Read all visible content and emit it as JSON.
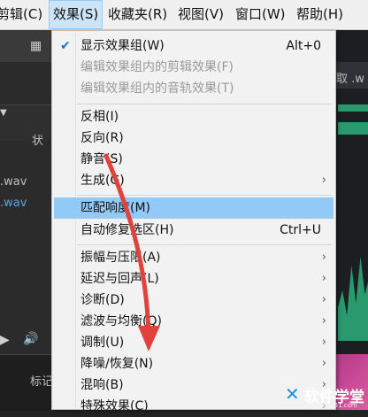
{
  "menubar": {
    "items": [
      {
        "label": "剪辑(C)"
      },
      {
        "label": "效果(S)"
      },
      {
        "label": "收藏夹(R)"
      },
      {
        "label": "视图(V)"
      },
      {
        "label": "窗口(W)"
      },
      {
        "label": "帮助(H)"
      }
    ]
  },
  "app": {
    "tab_partial": "状",
    "file1": ".wav",
    "file2": ".wav",
    "right_tab": "取 .w",
    "bottom_label": "标记"
  },
  "effects_menu": {
    "items": [
      {
        "label": "显示效果组(W)",
        "shortcut": "Alt+0",
        "checked": true
      },
      {
        "label": "编辑效果组内的剪辑效果(F)",
        "disabled": true
      },
      {
        "label": "编辑效果组内的音轨效果(T)",
        "disabled": true
      },
      {
        "label": "反相(I)"
      },
      {
        "label": "反向(R)"
      },
      {
        "label": "静音(S)"
      },
      {
        "label": "生成(G)",
        "submenu": true
      },
      {
        "label": "匹配响度(M)",
        "highlighted": true
      },
      {
        "label": "自动修复选区(H)",
        "shortcut": "Ctrl+U"
      },
      {
        "label": "振幅与压限(A)",
        "submenu": true
      },
      {
        "label": "延迟与回声(L)",
        "submenu": true
      },
      {
        "label": "诊断(D)",
        "submenu": true
      },
      {
        "label": "滤波与均衡(Q)",
        "submenu": true
      },
      {
        "label": "调制(U)",
        "submenu": true
      },
      {
        "label": "降噪/恢复(N)",
        "submenu": true
      },
      {
        "label": "混响(B)",
        "submenu": true
      },
      {
        "label": "特殊效果(C)",
        "submenu": true
      }
    ],
    "checkmark_glyph": "✔",
    "submenu_glyph": "›"
  },
  "watermark": {
    "title": "软件学堂",
    "subtitle": "www.xue51.com"
  },
  "colors": {
    "highlight": "#91c9f7",
    "annotation_arrow": "#e0433b",
    "app_background": "#232323"
  }
}
